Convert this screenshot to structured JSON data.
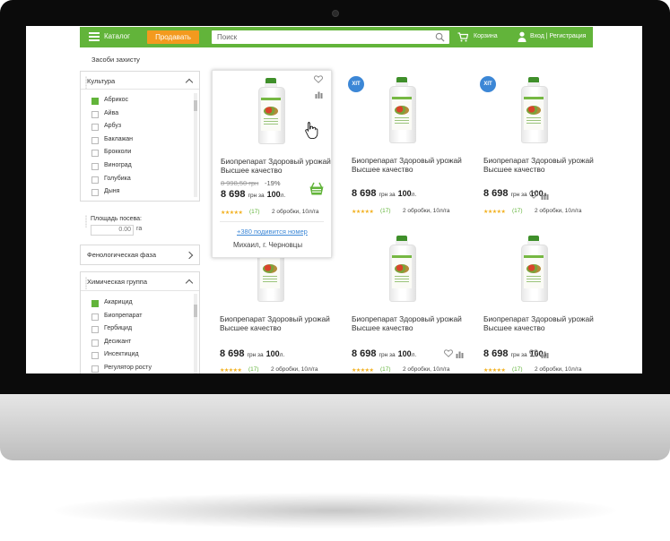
{
  "header": {
    "catalog_label": "Каталог",
    "sell_button": "Продавать",
    "search_placeholder": "Поиск",
    "cart_label": "Корзина",
    "login_label": "Вход | Регистрация"
  },
  "breadcrumb": "Засоби захисту",
  "filters": {
    "culture": {
      "title": "Культура",
      "items": [
        {
          "label": "Абрикос",
          "checked": true
        },
        {
          "label": "Айва",
          "checked": false
        },
        {
          "label": "Арбуз",
          "checked": false
        },
        {
          "label": "Баклажан",
          "checked": false
        },
        {
          "label": "Брокколи",
          "checked": false
        },
        {
          "label": "Виноград",
          "checked": false
        },
        {
          "label": "Голубика",
          "checked": false
        },
        {
          "label": "Дыня",
          "checked": false
        }
      ]
    },
    "area": {
      "label": "Площадь посева:",
      "value": "0.00",
      "unit": "га"
    },
    "phenology": {
      "title": "Фенологическая фаза"
    },
    "chemical": {
      "title": "Химическая группа",
      "items": [
        {
          "label": "Акарицид",
          "checked": true
        },
        {
          "label": "Биопрепарат",
          "checked": false
        },
        {
          "label": "Гербицид",
          "checked": false
        },
        {
          "label": "Десикант",
          "checked": false
        },
        {
          "label": "Инсектицид",
          "checked": false
        },
        {
          "label": "Регулятор росту",
          "checked": false
        }
      ]
    }
  },
  "products": [
    {
      "title": "Биопрепарат Здоровый урожай Высшее качество",
      "old_price": "8 998,50 грн",
      "discount": "-19%",
      "price": "8 698",
      "price_unit": "грн за",
      "qty": "100",
      "qty_unit": "л.",
      "stars": "★★★★★",
      "reviews": "(17)",
      "usage": "2 обробки, 10л/га",
      "badge": "",
      "hover": true,
      "phone": "+380 подивится номер",
      "seller": "Михаил, г. Черновцы"
    },
    {
      "title": "Биопрепарат Здоровый урожай Высшее качество",
      "price": "8 698",
      "price_unit": "грн за",
      "qty": "100",
      "qty_unit": "л.",
      "stars": "★★★★★",
      "reviews": "(17)",
      "usage": "2 обробки, 10л/га",
      "badge": "ХІТ"
    },
    {
      "title": "Биопрепарат Здоровый урожай Высшее качество",
      "price": "8 698",
      "price_unit": "грн за",
      "qty": "100",
      "qty_unit": "л.",
      "stars": "★★★★★",
      "reviews": "(17)",
      "usage": "2 обробки, 10л/га",
      "badge": "ХІТ"
    },
    {
      "title": "Биопрепарат Здоровый урожай Высшее качество",
      "price": "8 698",
      "price_unit": "грн за",
      "qty": "100",
      "qty_unit": "л.",
      "stars": "★★★★★",
      "reviews": "(17)",
      "usage": "2 обробки, 10л/га",
      "badge": ""
    },
    {
      "title": "Биопрепарат Здоровый урожай Высшее качество",
      "price": "8 698",
      "price_unit": "грн за",
      "qty": "100",
      "qty_unit": "л.",
      "stars": "★★★★★",
      "reviews": "(17)",
      "usage": "2 обробки, 10л/га",
      "badge": ""
    },
    {
      "title": "Биопрепарат Здоровый урожай Высшее качество",
      "price": "8 698",
      "price_unit": "грн за",
      "qty": "100",
      "qty_unit": "л.",
      "stars": "★★★★★",
      "reviews": "(17)",
      "usage": "2 обробки, 10л/га",
      "badge": ""
    }
  ],
  "colors": {
    "brand_green": "#62b43a",
    "sell_orange": "#f39a1e",
    "hit_blue": "#3c87d6"
  }
}
